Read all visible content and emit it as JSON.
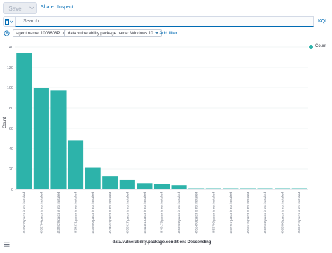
{
  "toolbar": {
    "save_label": "Save",
    "share_label": "Share",
    "inspect_label": "Inspect"
  },
  "query": {
    "placeholder": "Search",
    "language": "KQL"
  },
  "filters": {
    "pills": [
      "agent.name: 1003608P",
      "data.vulnerability.package.name: Windows 10"
    ],
    "add_label": "+ Add filter"
  },
  "colors": {
    "bar": "#2db3aa",
    "link": "#006bb4",
    "grid": "#eef0f3"
  },
  "chart_data": {
    "type": "bar",
    "series": [
      {
        "name": "Count",
        "values": [
          134,
          100,
          97,
          48,
          21,
          13,
          9,
          6,
          5,
          4,
          1,
          1,
          1,
          1,
          1,
          1,
          1
        ]
      }
    ],
    "categories": [
      "4540670 patch is not installed",
      "4532784 patch is not installed",
      "4532629 patch is not installed",
      "4534271 patch is not installed",
      "4535680 patch is not installed",
      "4534593 patch is not installed",
      "4538917 patch is not installed",
      "4541481 patch is not installed",
      "4549173 patch is not installed",
      "4550922 patch is not installed",
      "4555450 patch is not installed",
      "4556799 patch is not installed",
      "4557957 patch is not installed",
      "4561616 patch is not installed",
      "4562562 patch is not installed",
      "4565508 patch is not installed",
      "4566424 patch is not installed"
    ],
    "ylabel": "Count",
    "xlabel": "data.vulnerability.package.condition: Descending",
    "ylim": [
      0,
      140
    ],
    "yticks": [
      0,
      20,
      40,
      60,
      80,
      100,
      120,
      140
    ],
    "grid": true,
    "legend": "top-right"
  }
}
